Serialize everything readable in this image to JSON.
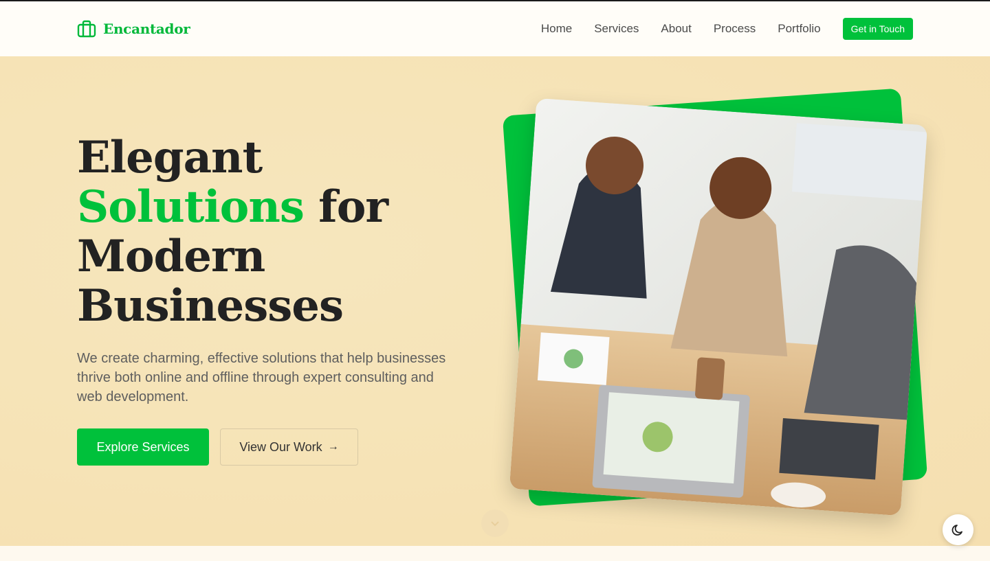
{
  "brand": {
    "name": "Encantador",
    "icon": "briefcase-icon",
    "color": "#00b83a"
  },
  "nav": {
    "links": [
      "Home",
      "Services",
      "About",
      "Process",
      "Portfolio"
    ],
    "cta": "Get in Touch"
  },
  "hero": {
    "headline_line1": "Elegant",
    "headline_accent": "Solutions",
    "headline_line2_rest": " for",
    "headline_line3": "Modern",
    "headline_line4": "Businesses",
    "lead": "We create charming, effective solutions that help businesses thrive both online and offline through expert consulting and web development.",
    "primary_button": "Explore Services",
    "secondary_button": "View Our Work",
    "secondary_icon": "arrow-right-icon",
    "image_alt": "team-meeting-photo"
  },
  "colors": {
    "accent": "#00c13b",
    "hero_bg": "#f6e3b6",
    "text": "#222222"
  },
  "theme_toggle_icon": "moon-icon",
  "scroll_icon": "chevron-down-icon"
}
